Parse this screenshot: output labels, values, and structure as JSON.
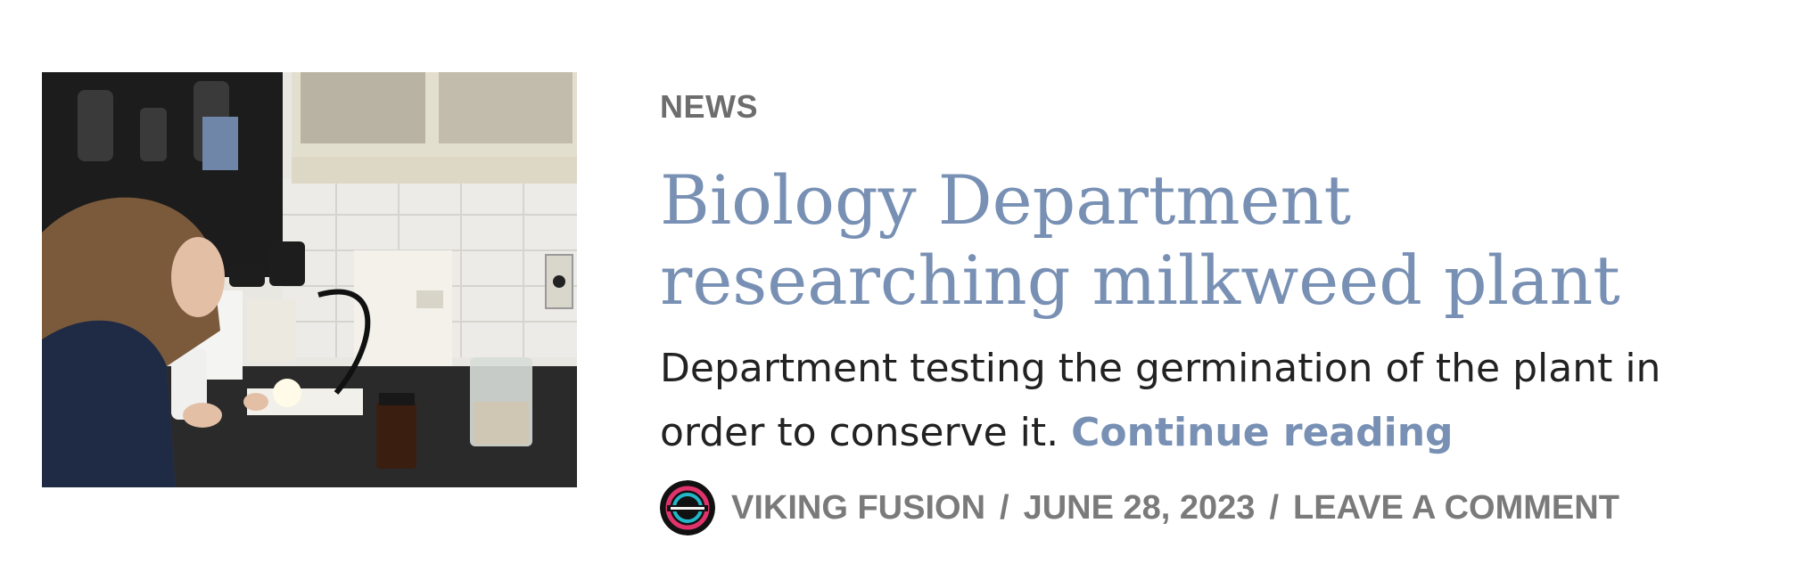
{
  "post": {
    "category": "NEWS",
    "title": "Biology Department researching milkweed plant",
    "excerpt": "Department testing the germination of the plant in order to conserve it.",
    "continue_label": "Continue reading",
    "thumbnail_icon": "lab-microscope-photo",
    "meta": {
      "author": "VIKING FUSION",
      "date": "JUNE 28, 2023",
      "comment_label": "LEAVE A COMMENT",
      "separator": "/",
      "avatar_icon": "viking-fusion-logo-avatar"
    }
  },
  "colors": {
    "accent": "#7890b4",
    "meta_gray": "#7a7a7a",
    "body_text": "#222222"
  }
}
